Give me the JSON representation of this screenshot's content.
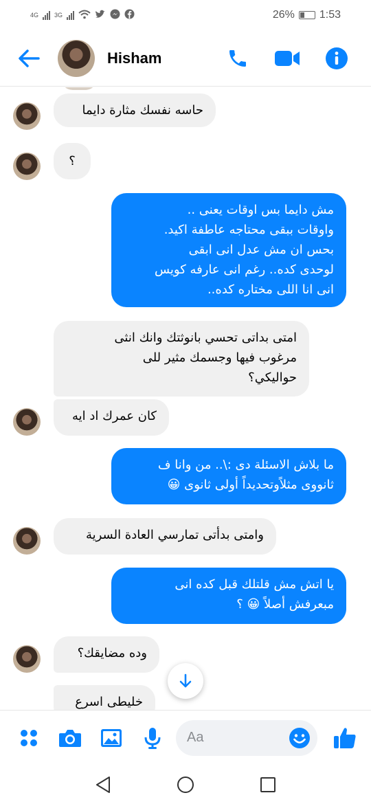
{
  "status_bar": {
    "network1": "4G",
    "network2": "3G",
    "battery": "26%",
    "time": "1:53"
  },
  "header": {
    "contact_name": "Hisham",
    "icons": [
      "back-arrow-icon",
      "phone-icon",
      "video-icon",
      "info-icon"
    ]
  },
  "messages": [
    {
      "side": "in",
      "text": "حاسه نفسك مثارة دايما"
    },
    {
      "side": "in",
      "text": "؟"
    },
    {
      "side": "out",
      "text": "مش دايما بس اوقات يعنى ..\nواوقات ببقى محتاجه عاطفة اكيد.\nبحس ان  مش عدل انى ابقى\nلوحدى كده.. رغم انى عارفه كويس\nانى انا اللى مختاره كده.."
    },
    {
      "side": "in",
      "text": "امتى بداتى تحسي بانوثتك وانك انثى\nمرغوب فيها وجسمك مثير للى\nحواليكي؟"
    },
    {
      "side": "in",
      "text": "كان عمرك اد ايه"
    },
    {
      "side": "out",
      "text": "ما بلاش الاسئلة دى :\\.. من وانا ف\nثانووى مثلاًوتحديداً أولى ثانوى 😀"
    },
    {
      "side": "in",
      "text": "وامتى بدأتى تمارسي العادة السرية"
    },
    {
      "side": "out",
      "text": "يا اتش مش قلتلك قبل كده انى\nمبعرفش أصلاً 😀 ؟"
    },
    {
      "side": "in",
      "text": "وده مضايقك؟"
    },
    {
      "side": "in",
      "text": "خليطى اسرع"
    }
  ],
  "composer": {
    "placeholder": "Aa",
    "icons": [
      "apps-icon",
      "camera-icon",
      "gallery-icon",
      "microphone-icon",
      "emoji-icon",
      "like-icon"
    ]
  },
  "colors": {
    "accent": "#0a84ff",
    "incoming_bubble": "#f0f0f0",
    "outgoing_text": "#ffffff"
  }
}
